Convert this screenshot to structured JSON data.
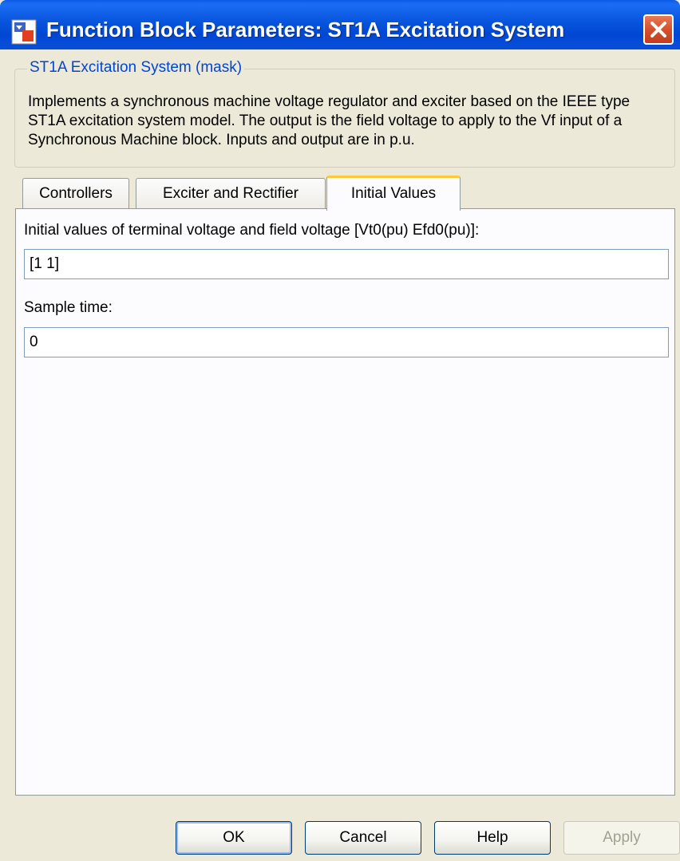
{
  "window": {
    "title": "Function Block Parameters: ST1A Excitation System",
    "app_icon": "simulink-block-icon",
    "close_icon": "close-icon"
  },
  "description": {
    "legend": "ST1A Excitation System (mask)",
    "text": "Implements a synchronous machine voltage regulator and exciter based on the IEEE type ST1A excitation system model. The output is the field voltage to apply to the Vf input of a Synchronous Machine block. Inputs and output are in p.u."
  },
  "tabs": [
    {
      "label": "Controllers",
      "active": false
    },
    {
      "label": "Exciter and Rectifier",
      "active": false
    },
    {
      "label": "Initial Values",
      "active": true
    }
  ],
  "panel": {
    "initial_values_label": "Initial values of terminal voltage and field voltage [Vt0(pu) Efd0(pu)]:",
    "initial_values_value": "[1 1]",
    "sample_time_label": "Sample time:",
    "sample_time_value": "0"
  },
  "buttons": {
    "ok": "OK",
    "cancel": "Cancel",
    "help": "Help",
    "apply": "Apply"
  },
  "colors": {
    "titlebar": "#0054e3",
    "legend_text": "#0046d5",
    "active_tab_accent": "#ffc83c",
    "dialog_bg": "#ece9d8",
    "close_button": "#d6502c"
  }
}
